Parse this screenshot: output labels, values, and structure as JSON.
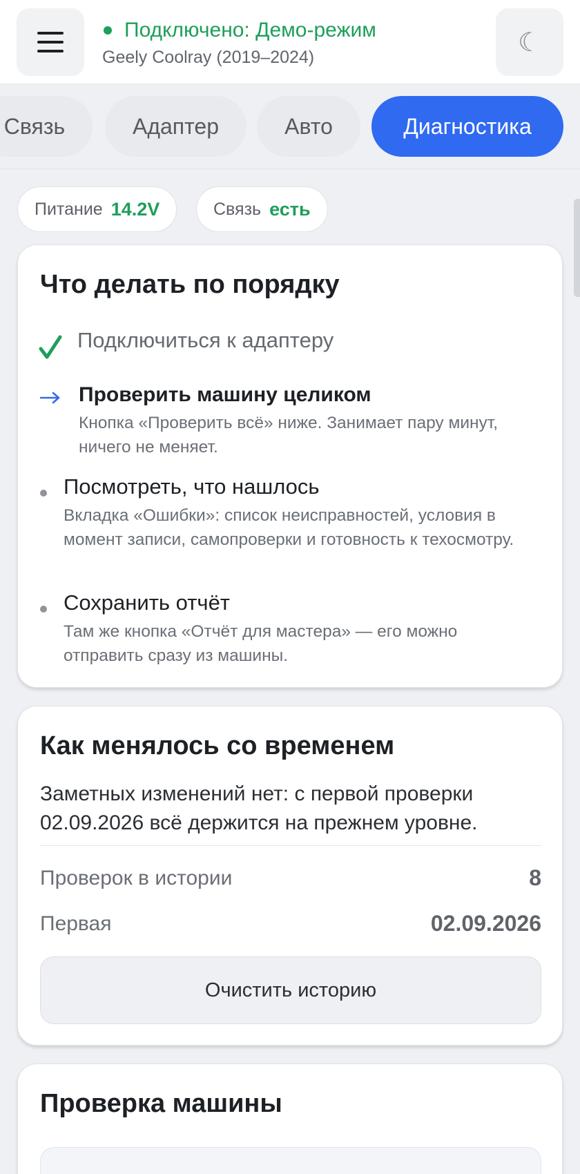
{
  "header": {
    "status": "Подключено: Демо-режим",
    "vehicle": "Geely Coolray (2019–2024)",
    "theme_icon": "☾",
    "status_color": "#1e9e5b"
  },
  "tabs": [
    {
      "label": "Связь",
      "active": false
    },
    {
      "label": "Адаптер",
      "active": false
    },
    {
      "label": "Авто",
      "active": false
    },
    {
      "label": "Диагностика",
      "active": true
    }
  ],
  "chips": {
    "power": {
      "label": "Питание",
      "value": "14.2V"
    },
    "link": {
      "label": "Связь",
      "value": "есть"
    }
  },
  "steps_card": {
    "title": "Что делать по порядку",
    "steps": [
      {
        "state": "done",
        "marker": "✓",
        "title": "Подключиться к адаптеру",
        "description": ""
      },
      {
        "state": "current",
        "marker": "→",
        "title": "Проверить машину целиком",
        "description": "Кнопка «Проверить всё» ниже. Занимает пару минут, ничего не меняет."
      },
      {
        "state": "pending",
        "marker": "•",
        "title": "Посмотреть, что нашлось",
        "description": "Вкладка «Ошибки»: список неисправностей, условия в момент записи, самопроверки и готовность к техосмотру."
      },
      {
        "state": "pending",
        "marker": "•",
        "title": "Сохранить отчёт",
        "description": "Там же кнопка «Отчёт для мастера» — его можно отправить сразу из машины."
      }
    ]
  },
  "history_card": {
    "title": "Как менялось со временем",
    "summary": "Заметных изменений нет: с первой проверки 02.09.2026 всё держится на прежнем уровне.",
    "rows": [
      {
        "key": "Проверок в истории",
        "value": "8"
      },
      {
        "key": "Первая",
        "value": "02.09.2026"
      }
    ],
    "clear_label": "Очистить историю"
  },
  "check_card": {
    "title": "Проверка машины"
  },
  "colors": {
    "accent": "#2f6af1",
    "success": "#1e9e5b"
  }
}
